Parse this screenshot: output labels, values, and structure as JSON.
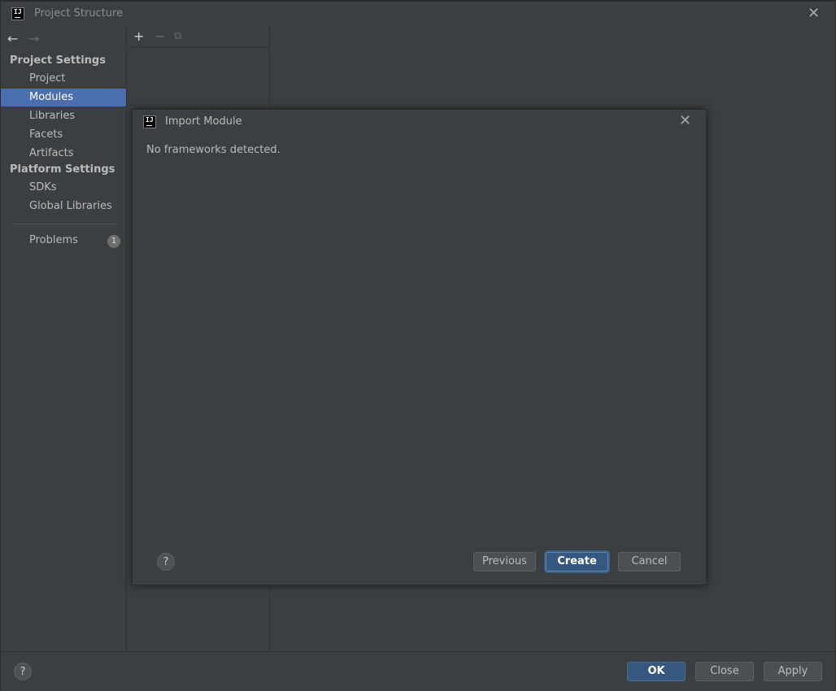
{
  "window": {
    "title": "Project Structure",
    "icon_text": "IJ",
    "close_icon": "✕"
  },
  "nav": {
    "back_icon": "←",
    "forward_icon": "→"
  },
  "sidebar": {
    "project_settings_header": "Project Settings",
    "platform_settings_header": "Platform Settings",
    "items": [
      {
        "label": "Project"
      },
      {
        "label": "Modules",
        "selected": true
      },
      {
        "label": "Libraries"
      },
      {
        "label": "Facets"
      },
      {
        "label": "Artifacts"
      },
      {
        "label": "SDKs"
      },
      {
        "label": "Global Libraries"
      }
    ],
    "problems": {
      "label": "Problems",
      "count": "1"
    }
  },
  "toolbar": {
    "add_icon": "+",
    "remove_icon": "−",
    "copy_icon": "⧉"
  },
  "dialog": {
    "title": "Import Module",
    "icon_text": "IJ",
    "close_icon": "✕",
    "message": "No frameworks detected.",
    "help_label": "?",
    "previous_label": "Previous",
    "create_label": "Create",
    "cancel_label": "Cancel"
  },
  "footer": {
    "help_label": "?",
    "ok_label": "OK",
    "close_label": "Close",
    "apply_label": "Apply"
  },
  "colors": {
    "background": "#3c3f41",
    "selection": "#4b6eaf",
    "primary_button": "#365880"
  }
}
